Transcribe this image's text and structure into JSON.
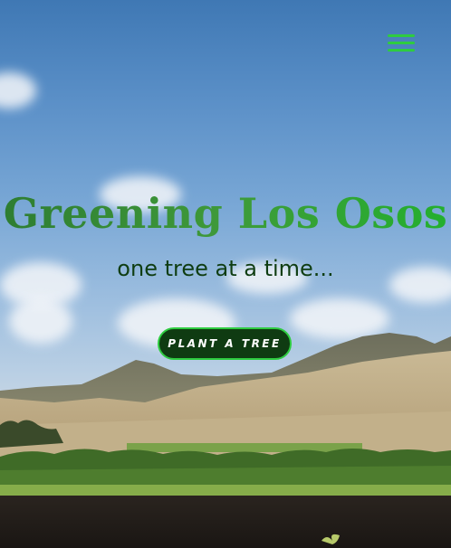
{
  "hero": {
    "title": "Greening Los Osos",
    "tagline": "one tree at a time...",
    "cta_label": "PLANT A TREE"
  },
  "header": {
    "menu_icon": "hamburger-menu-icon"
  },
  "colors": {
    "accent_green": "#2ecc40",
    "title_green": "#2e7d32",
    "tagline_green": "#0f3d12",
    "button_bg": "#0f3b12"
  }
}
